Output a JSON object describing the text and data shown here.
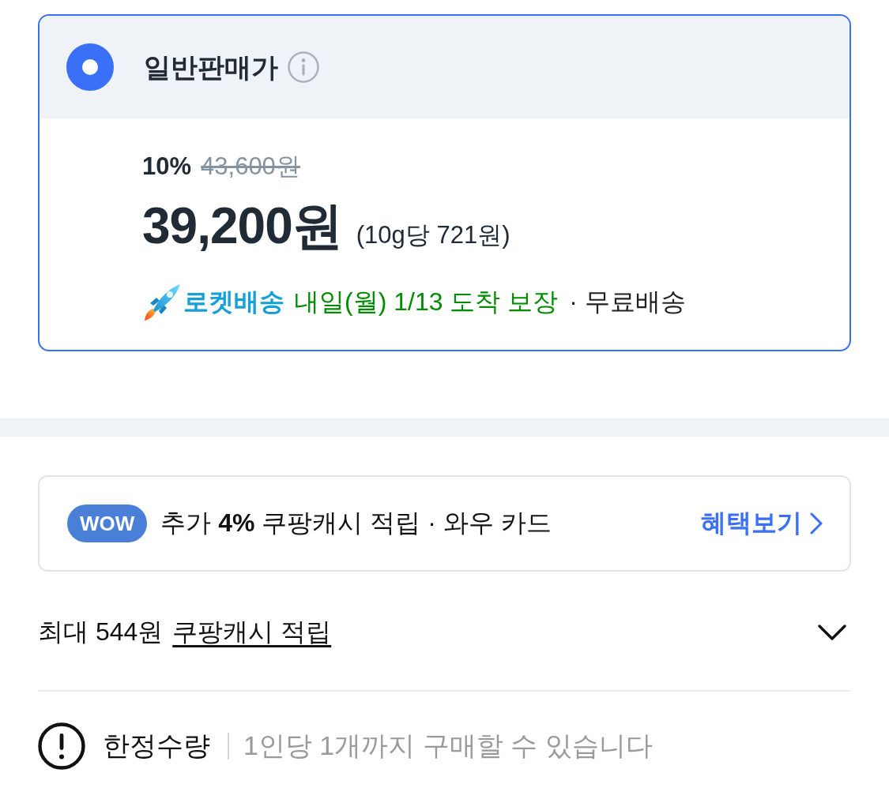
{
  "price_option": {
    "selected": true,
    "label": "일반판매가",
    "discount_rate": "10%",
    "original_price": "43,600원",
    "price": "39,200원",
    "unit_price": "(10g당 721원)",
    "delivery": {
      "badge": "로켓배송",
      "arrival": "내일(월) 1/13 도착 보장",
      "shipping": "· 무료배송"
    }
  },
  "wow_banner": {
    "badge": "WOW",
    "text": "추가 **4%** 쿠팡캐시 적립 · 와우 카드",
    "link": "혜택보기"
  },
  "cashback": {
    "prefix": "최대 544원",
    "link": "쿠팡캐시 적립",
    "expanded": false
  },
  "notice": {
    "title": "한정수량",
    "text": "1인당 1개까지 구매할 수 있습니다"
  }
}
